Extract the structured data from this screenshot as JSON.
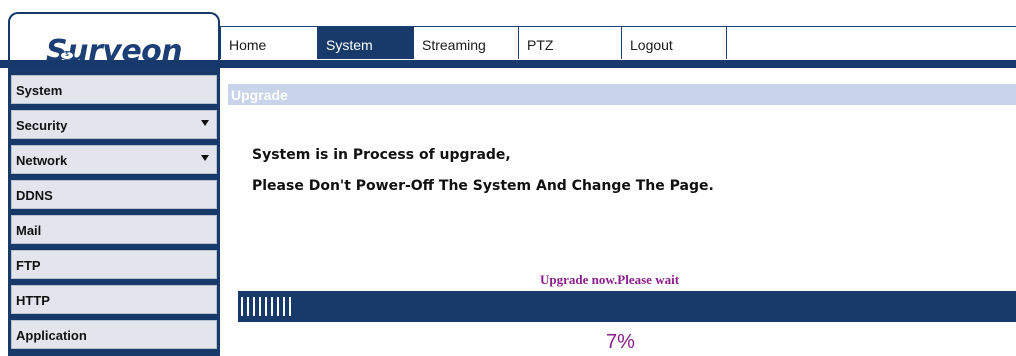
{
  "brand": {
    "logo_text": "Surveon",
    "logo_mark": "S"
  },
  "nav": {
    "tabs": [
      {
        "label": "Home",
        "active": false
      },
      {
        "label": "System",
        "active": true
      },
      {
        "label": "Streaming",
        "active": false
      },
      {
        "label": "PTZ",
        "active": false
      },
      {
        "label": "Logout",
        "active": false
      }
    ]
  },
  "sidebar": {
    "items": [
      {
        "label": "System",
        "has_dropdown": false
      },
      {
        "label": "Security",
        "has_dropdown": true
      },
      {
        "label": "Network",
        "has_dropdown": true
      },
      {
        "label": "DDNS",
        "has_dropdown": false
      },
      {
        "label": "Mail",
        "has_dropdown": false
      },
      {
        "label": "FTP",
        "has_dropdown": false
      },
      {
        "label": "HTTP",
        "has_dropdown": false
      },
      {
        "label": "Application",
        "has_dropdown": false
      }
    ]
  },
  "content": {
    "title": "Upgrade",
    "message_line1": "System is in Process of upgrade,",
    "message_line2": "Please Don't Power-Off The System And Change The Page.",
    "wait_text": "Upgrade now.Please wait",
    "progress_percent": 7,
    "progress_label": "7%"
  },
  "colors": {
    "navy": "#173a6b",
    "title_bar": "#c7d4ea",
    "accent_purple": "#8a1f8c",
    "sidebar_item_bg": "#e2e6ec"
  },
  "icons": {
    "dropdown": "triangle-down-icon"
  }
}
